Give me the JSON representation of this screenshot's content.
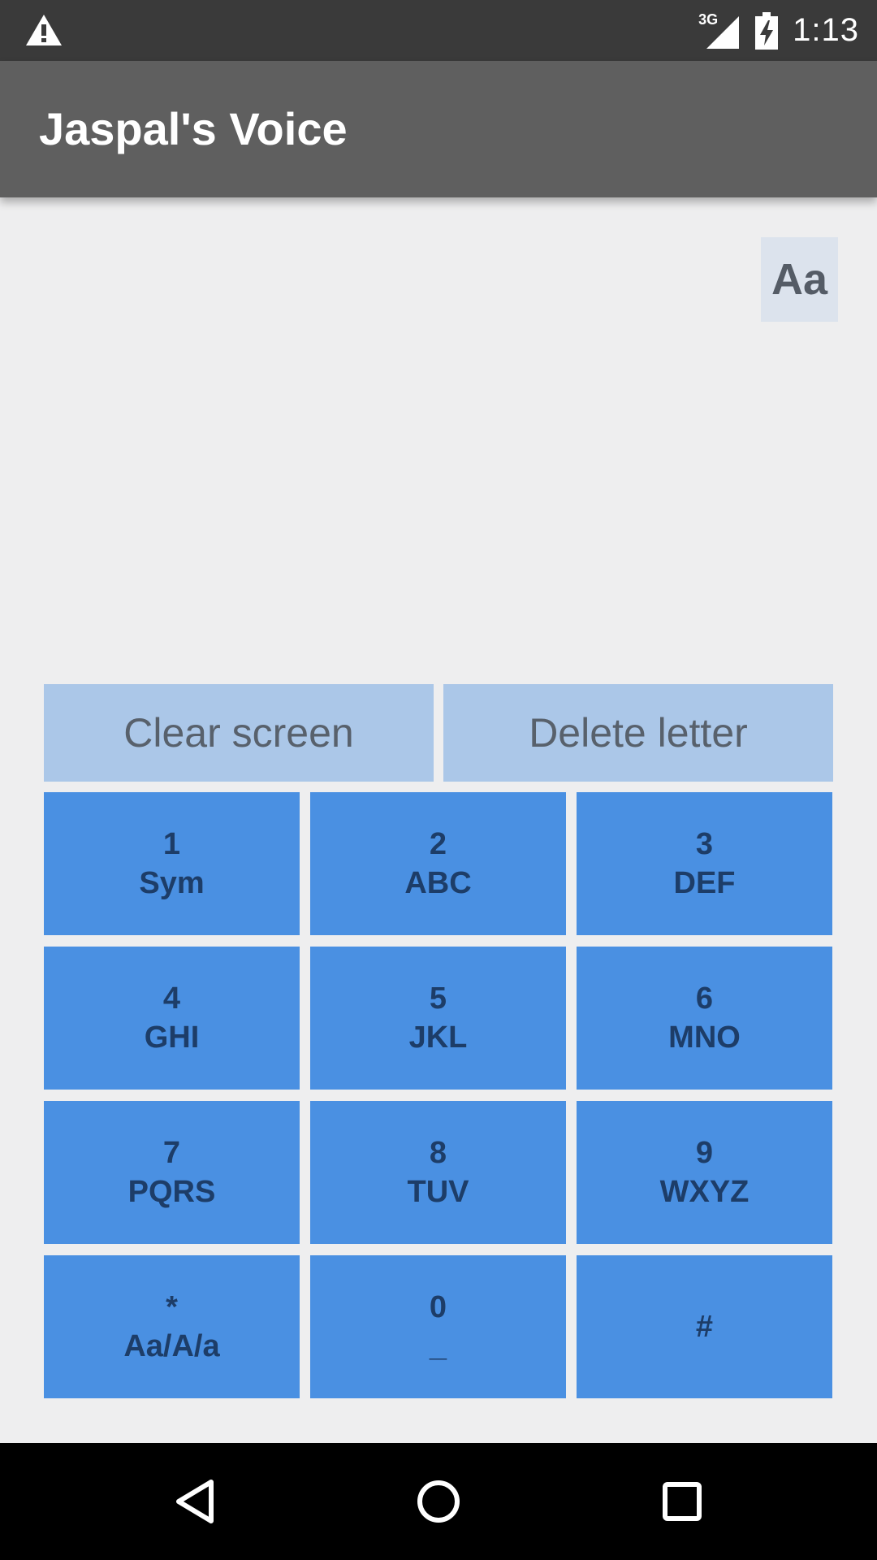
{
  "status_bar": {
    "network": "3G",
    "time": "1:13",
    "icons": [
      "warning-icon",
      "signal-icon",
      "battery-charging-icon"
    ]
  },
  "app_bar": {
    "title": "Jaspal's Voice"
  },
  "case_toggle": {
    "label": "Aa"
  },
  "actions": {
    "clear_label": "Clear screen",
    "delete_label": "Delete letter"
  },
  "keys": [
    {
      "digit": "1",
      "letters": "Sym"
    },
    {
      "digit": "2",
      "letters": "ABC"
    },
    {
      "digit": "3",
      "letters": "DEF"
    },
    {
      "digit": "4",
      "letters": "GHI"
    },
    {
      "digit": "5",
      "letters": "JKL"
    },
    {
      "digit": "6",
      "letters": "MNO"
    },
    {
      "digit": "7",
      "letters": "PQRS"
    },
    {
      "digit": "8",
      "letters": "TUV"
    },
    {
      "digit": "9",
      "letters": "WXYZ"
    },
    {
      "digit": "*",
      "letters": "Aa/A/a"
    },
    {
      "digit": "0",
      "letters": "_"
    },
    {
      "digit": "#",
      "letters": ""
    }
  ],
  "nav_bar": {
    "icons": [
      "back-icon",
      "home-icon",
      "recents-icon"
    ]
  },
  "colors": {
    "key_bg": "#4a90e2",
    "key_text": "#1d3d68",
    "action_bg": "#abc7e8",
    "app_bar": "#5f5f5f",
    "status_bar": "#3a3a3a"
  }
}
